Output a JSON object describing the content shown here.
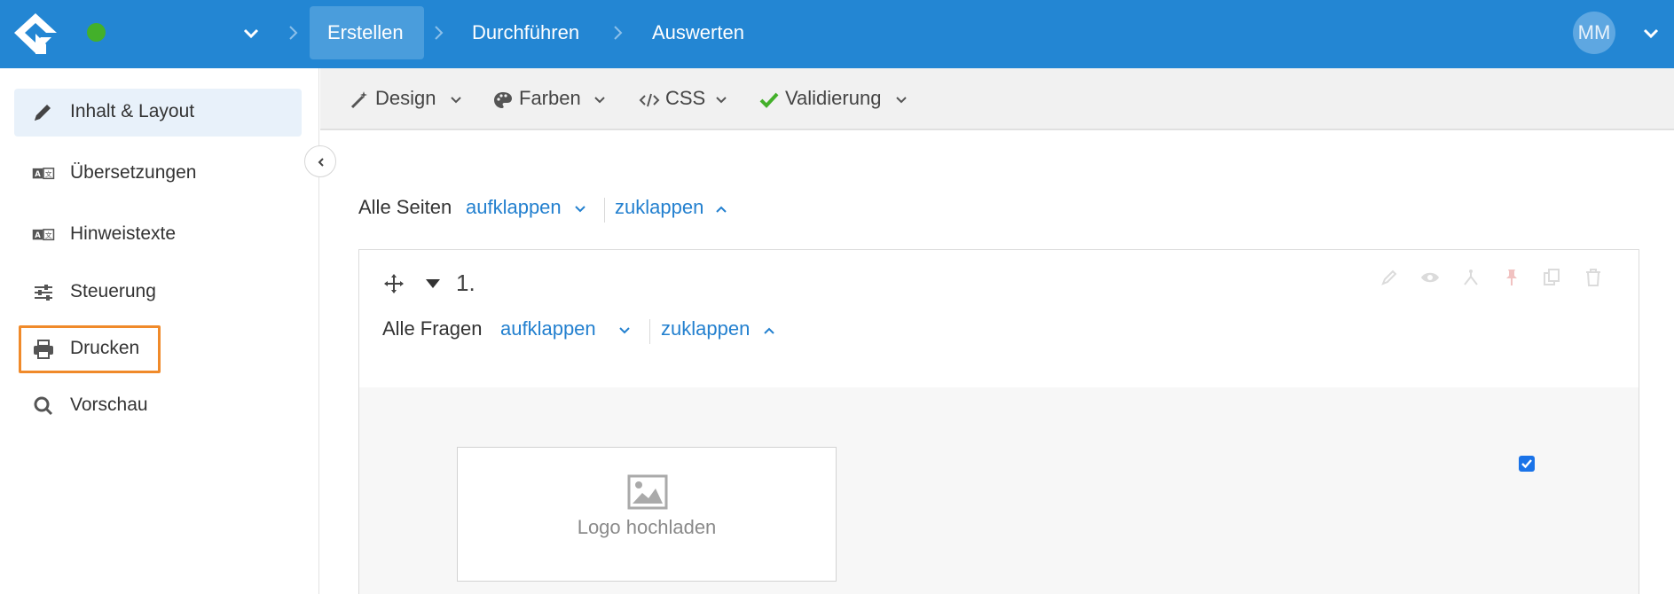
{
  "header": {
    "breadcrumbs": [
      {
        "label": "Erstellen",
        "active": true
      },
      {
        "label": "Durchführen",
        "active": false
      },
      {
        "label": "Auswerten",
        "active": false
      }
    ],
    "user_initials": "MM",
    "status_color": "#43b02a",
    "brand_color": "#2386d3"
  },
  "sidebar": {
    "items": [
      {
        "label": "Inhalt & Layout",
        "icon": "pencil-icon",
        "active": true
      },
      {
        "label": "Übersetzungen",
        "icon": "translate-icon",
        "active": false
      },
      {
        "label": "Hinweistexte",
        "icon": "translate-icon",
        "active": false
      },
      {
        "label": "Steuerung",
        "icon": "sliders-icon",
        "active": false
      },
      {
        "label": "Drucken",
        "icon": "printer-icon",
        "active": false,
        "highlighted": true
      },
      {
        "label": "Vorschau",
        "icon": "search-icon",
        "active": false
      }
    ],
    "highlight_color": "#f08a2a"
  },
  "toolbar": {
    "items": [
      {
        "label": "Design",
        "icon": "magic-wand-icon"
      },
      {
        "label": "Farben",
        "icon": "palette-icon"
      },
      {
        "label": "CSS",
        "icon": "code-icon"
      },
      {
        "label": "Validierung",
        "icon": "check-icon"
      }
    ]
  },
  "pages_controls": {
    "label": "Alle Seiten",
    "expand": "aufklappen",
    "collapse": "zuklappen"
  },
  "page": {
    "number": "1.",
    "questions_controls": {
      "label": "Alle Fragen",
      "expand": "aufklappen",
      "collapse": "zuklappen"
    },
    "actions": [
      "edit-icon",
      "eye-icon",
      "branch-icon",
      "pin-icon",
      "copy-icon",
      "trash-icon"
    ],
    "logo_upload_label": "Logo hochladen",
    "checkbox_checked": true
  }
}
